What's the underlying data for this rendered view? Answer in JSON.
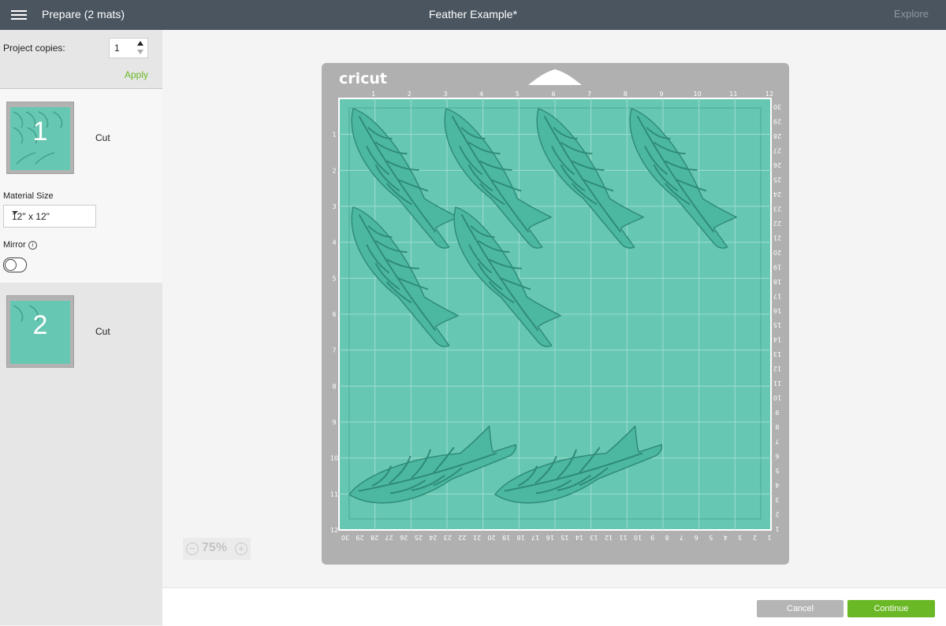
{
  "header": {
    "title": "Prepare (2 mats)",
    "project_name": "Feather Example*",
    "explore_label": "Explore"
  },
  "sidebar": {
    "copies_label": "Project copies:",
    "copies_value": "1",
    "apply_label": "Apply",
    "mats": [
      {
        "number": "1",
        "label": "Cut"
      },
      {
        "number": "2",
        "label": "Cut"
      }
    ],
    "material_size_label": "Material Size",
    "material_size_value": "12\" x 12\"",
    "mirror_label": "Mirror",
    "mirror_on": false
  },
  "mat": {
    "brand": "cricut",
    "top_ruler": [
      "1",
      "2",
      "3",
      "4",
      "5",
      "6",
      "7",
      "8",
      "9",
      "10",
      "11",
      "12"
    ],
    "left_ruler": [
      "1",
      "2",
      "3",
      "4",
      "5",
      "6",
      "7",
      "8",
      "9",
      "10",
      "11",
      "12"
    ],
    "bottom_ruler": [
      "30",
      "29",
      "28",
      "27",
      "26",
      "25",
      "24",
      "23",
      "22",
      "21",
      "20",
      "19",
      "18",
      "17",
      "16",
      "15",
      "14",
      "13",
      "12",
      "11",
      "10",
      "9",
      "8",
      "7",
      "6",
      "5",
      "4",
      "3",
      "2",
      "1"
    ],
    "right_ruler": [
      "30",
      "29",
      "28",
      "27",
      "26",
      "25",
      "24",
      "23",
      "22",
      "21",
      "20",
      "19",
      "18",
      "17",
      "16",
      "15",
      "14",
      "13",
      "12",
      "11",
      "10",
      "9",
      "8",
      "7",
      "6",
      "5",
      "4",
      "3",
      "2",
      "1"
    ],
    "colors": {
      "mat_bg": "#66c7b2",
      "feather": "#4cb8a1",
      "frame": "#b0b0b0"
    }
  },
  "zoom": {
    "value": "75%"
  },
  "footer": {
    "cancel_label": "Cancel",
    "continue_label": "Continue"
  }
}
